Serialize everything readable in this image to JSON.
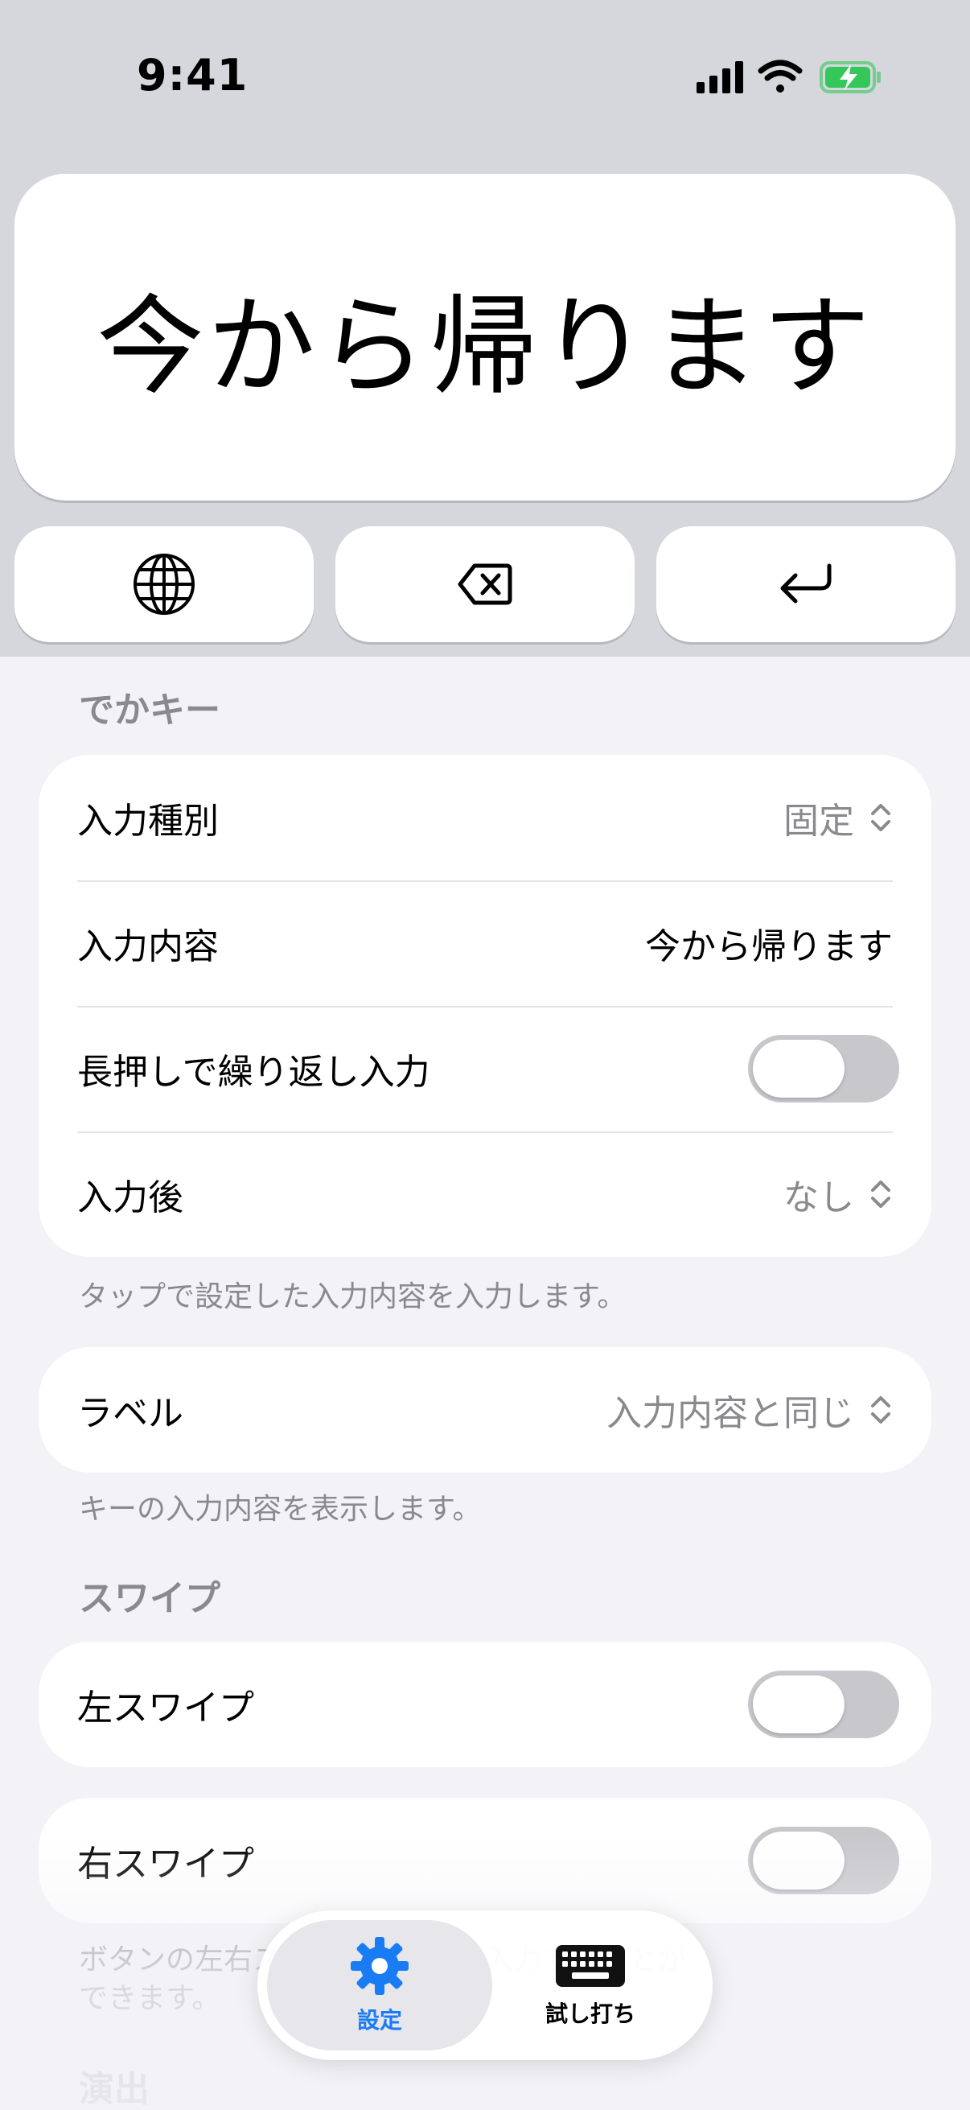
{
  "status_bar": {
    "time": "9:41"
  },
  "keyboard": {
    "big_key_label": "今から帰ります",
    "globe_icon": "globe-icon",
    "delete_icon": "delete-backward-icon",
    "return_icon": "return-icon"
  },
  "section_dekakey": {
    "header": "でかキー",
    "rows": {
      "input_type": {
        "label": "入力種別",
        "value": "固定"
      },
      "input_content": {
        "label": "入力内容",
        "value": "今から帰ります"
      },
      "repeat": {
        "label": "長押しで繰り返し入力",
        "on": false
      },
      "after_input": {
        "label": "入力後",
        "value": "なし"
      }
    },
    "footnote": "タップで設定した入力内容を入力します。"
  },
  "label_group": {
    "label": "ラベル",
    "value": "入力内容と同じ",
    "footnote": "キーの入力内容を表示します。"
  },
  "section_swipe": {
    "header": "スワイプ",
    "left": {
      "label": "左スワイプ",
      "on": false
    },
    "right": {
      "label": "右スワイプ",
      "on": false
    },
    "footnote_line1": "ボタンの左右スワイプで文字を入力することが",
    "footnote_line2": "できます。"
  },
  "section_effect": {
    "header": "演出"
  },
  "tab_bar": {
    "tabs": [
      {
        "label": "設定",
        "icon": "gear-icon",
        "selected": true
      },
      {
        "label": "試し打ち",
        "icon": "keyboard-icon",
        "selected": false
      }
    ]
  },
  "colors": {
    "accent": "#1a7cf5",
    "battery": "#34c759",
    "toggle_off": "#c7c7cc"
  }
}
